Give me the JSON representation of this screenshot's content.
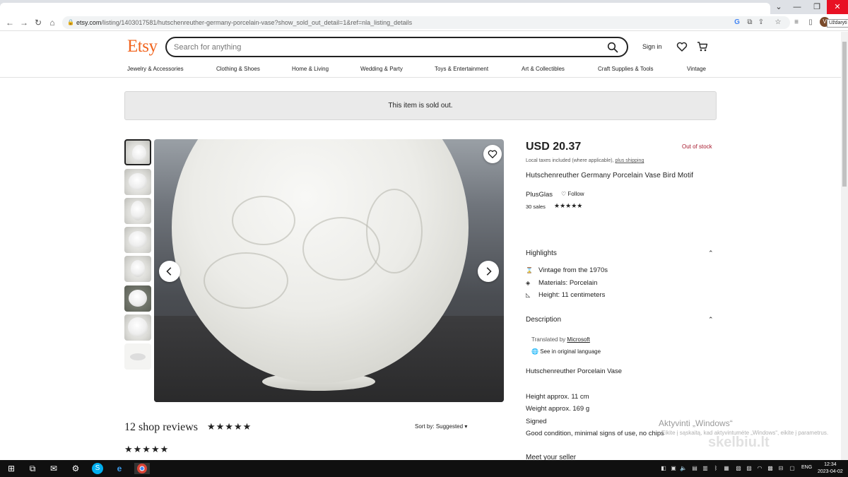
{
  "browser": {
    "url_host": "etsy.com",
    "url_path": "/listing/1403017581/hutschenreuther-germany-porcelain-vase?show_sold_out_detail=1&ref=nla_listing_details",
    "profile_initial": "V",
    "profile_tooltip": "Uždaryti"
  },
  "header": {
    "logo": "Etsy",
    "search_placeholder": "Search for anything",
    "signin": "Sign in"
  },
  "categories": [
    "Jewelry & Accessories",
    "Clothing & Shoes",
    "Home & Living",
    "Wedding & Party",
    "Toys & Entertainment",
    "Art & Collectibles",
    "Craft Supplies & Tools",
    "Vintage"
  ],
  "banner": {
    "soldout_text": "This item is sold out."
  },
  "listing": {
    "price": "USD 20.37",
    "stock_status": "Out of stock",
    "tax_note": "Local taxes included (where applicable),",
    "tax_link": "plus shipping",
    "title": "Hutschenreuther Germany Porcelain Vase Bird Motif",
    "shop_name": "PlusGlas",
    "follow": "Follow",
    "sales": "30 sales",
    "rating_stars": "★★★★★"
  },
  "highlights": {
    "heading": "Highlights",
    "items": [
      {
        "icon": "vintage-icon",
        "text": "Vintage from the 1970s"
      },
      {
        "icon": "materials-icon",
        "text": "Materials: Porcelain"
      },
      {
        "icon": "ruler-icon",
        "text": "Height: 11 centimeters"
      }
    ]
  },
  "description": {
    "heading": "Description",
    "translated_by": "Translated by",
    "translator": "Microsoft",
    "see_original": "See in original language",
    "lines": [
      "Hutschenreuther Porcelain Vase",
      "Height approx. 11 cm",
      "Weight approx. 169 g",
      "Signed",
      "Good condition, minimal signs of use, no chips"
    ],
    "meet_seller": "Meet your seller"
  },
  "reviews": {
    "heading": "12 shop reviews",
    "stars": "★★★★★",
    "sort_label": "Sort by:",
    "sort_value": "Suggested",
    "review_stars": "★★★★★"
  },
  "overlay": {
    "activate_title": "Aktyvinti „Windows“",
    "activate_sub": "Eikite į sąskaitą, kad aktyvintumėte „Windows“, eikite į parametrus.",
    "watermark": "skelbiu.lt"
  },
  "taskbar": {
    "language": "ENG",
    "time": "12:34",
    "date": "2023-04-02"
  }
}
